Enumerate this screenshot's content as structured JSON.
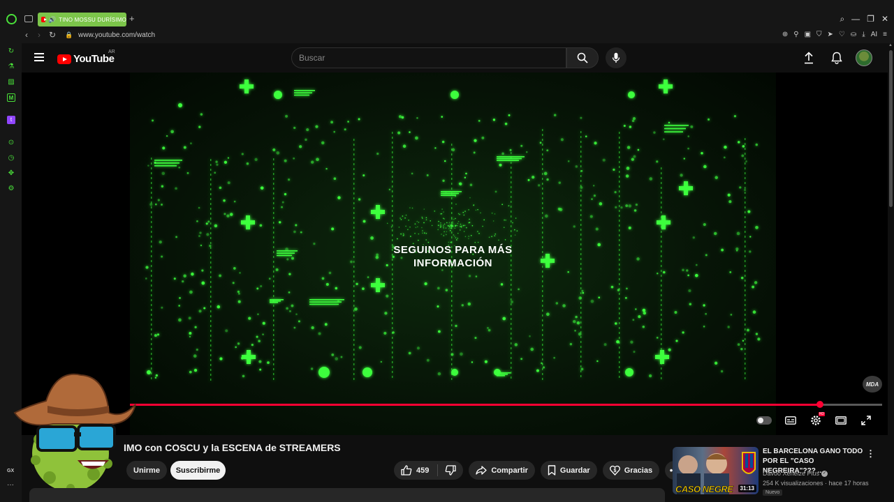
{
  "browser": {
    "tab_title": "TINO MOSSU DURÍSIMO",
    "tab_speaker": "🔊",
    "url": "www.youtube.com/watch",
    "addr_ai_label": "AI",
    "sidebar_gx": "GX",
    "sidebar_more": "···"
  },
  "youtube": {
    "logo_word": "YouTube",
    "logo_region": "AR",
    "search_placeholder": "Buscar"
  },
  "player": {
    "overlay_line1": "SEGUINOS PARA MÁS",
    "overlay_line2": "INFORMACIÓN",
    "watermark": "MDA",
    "progress": 0.917,
    "quality_badge": "HD"
  },
  "video": {
    "title_visible": "IMO con COSCU y la ESCENA de STREAMERS",
    "join_label": "Unirme",
    "subscribe_label": "Suscribirme",
    "like_count": "459",
    "share_label": "Compartir",
    "save_label": "Guardar",
    "thanks_label": "Gracias",
    "more_label": "•••"
  },
  "recommendation": {
    "title": "EL BARCELONA GANO TODO POR EL \"CASO NEGREIRA\"??? ...",
    "channel": "Davoo Xeneize Plus",
    "meta": "254 K visualizaciones · hace 17 horas",
    "badge": "Nuevo",
    "duration": "31:13",
    "thumb_text": "CASO NEGRE",
    "menu": "⋮"
  },
  "colors": {
    "accent_green": "#4ae13a",
    "yt_red": "#ff0000",
    "progress_red": "#ff0033",
    "matrix_green": "#3cff3c"
  }
}
